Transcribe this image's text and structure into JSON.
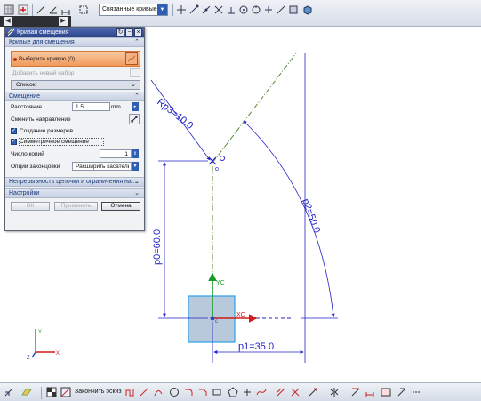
{
  "toolbar": {
    "constraint_filter": "Связанные кривые",
    "nav_back": "◀",
    "nav_forward": "▶"
  },
  "dialog": {
    "title": "Кривая смещения",
    "group_curve": {
      "title": "Кривые для смещения",
      "select_label": "Выберите кривую (0)",
      "add_set_label": "Добавить новый набор",
      "list_label": "Список"
    },
    "group_offset": {
      "title": "Смещение",
      "distance_label": "Расстояние",
      "distance_value": "1.5",
      "distance_unit": "mm",
      "reverse_label": "Сменить направление",
      "create_dims_label": "Создание размеров",
      "symmetric_label": "Симметричное смещение",
      "copies_label": "Число копий",
      "copies_value": "1",
      "cap_label": "Опции законцовки",
      "cap_value": "Расширить касательн"
    },
    "group_chain": {
      "title": "Непрерывность цепочки и ограничения на ..."
    },
    "group_settings": {
      "title": "Настройки"
    },
    "buttons": {
      "ok": "ОК",
      "apply": "Применить",
      "cancel": "Отмена"
    }
  },
  "sketch": {
    "dim_p0": "p0=60.0",
    "dim_p1": "p1=35.0",
    "dim_p2": "p2=50.0",
    "dim_rp3": "Rp3=10.0",
    "axis_xc": "XC",
    "axis_yc": "YC",
    "axis_x": "X",
    "axis_y": "Y",
    "axis_z": "Z"
  },
  "bottom_toolbar": {
    "finish_sketch": "Закончить эскиз"
  },
  "colors": {
    "dimension": "#2323c8",
    "centerline": "#5a8a3a",
    "square_fill": "#b9c9dc",
    "square_stroke": "#2aa0e8",
    "axis_x": "#d11b1b",
    "axis_y": "#1a9a2a",
    "axis_z": "#2a4ab8",
    "title_bar": "#3a56a0",
    "selection": "#f19a5a"
  }
}
